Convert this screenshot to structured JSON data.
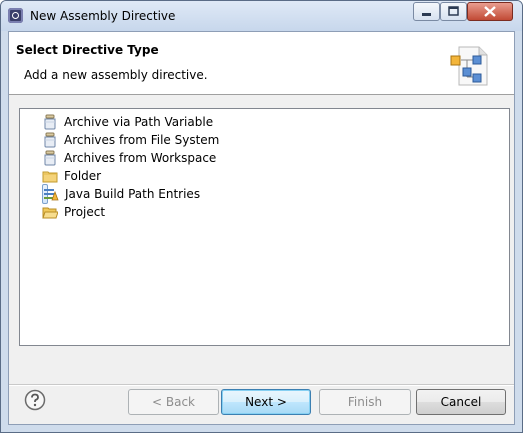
{
  "window": {
    "title": "New Assembly Directive"
  },
  "header": {
    "title": "Select Directive Type",
    "description": "Add a new assembly directive."
  },
  "tree": {
    "items": [
      {
        "label": "Archive via Path Variable",
        "icon": "jar-icon",
        "selected": false
      },
      {
        "label": "Archives from File System",
        "icon": "jar-icon",
        "selected": false
      },
      {
        "label": "Archives from Workspace",
        "icon": "jar-icon",
        "selected": false
      },
      {
        "label": "Folder",
        "icon": "folder-icon",
        "selected": false
      },
      {
        "label": "Java Build Path Entries",
        "icon": "build-path-icon",
        "selected": true
      },
      {
        "label": "Project",
        "icon": "project-folder-icon",
        "selected": false
      }
    ]
  },
  "buttons": {
    "back": "< Back",
    "next": "Next >",
    "finish": "Finish",
    "cancel": "Cancel"
  },
  "colors": {
    "selection_border": "#7da2ce",
    "default_button_border": "#3c7fb1",
    "close_button": "#c14a35"
  }
}
